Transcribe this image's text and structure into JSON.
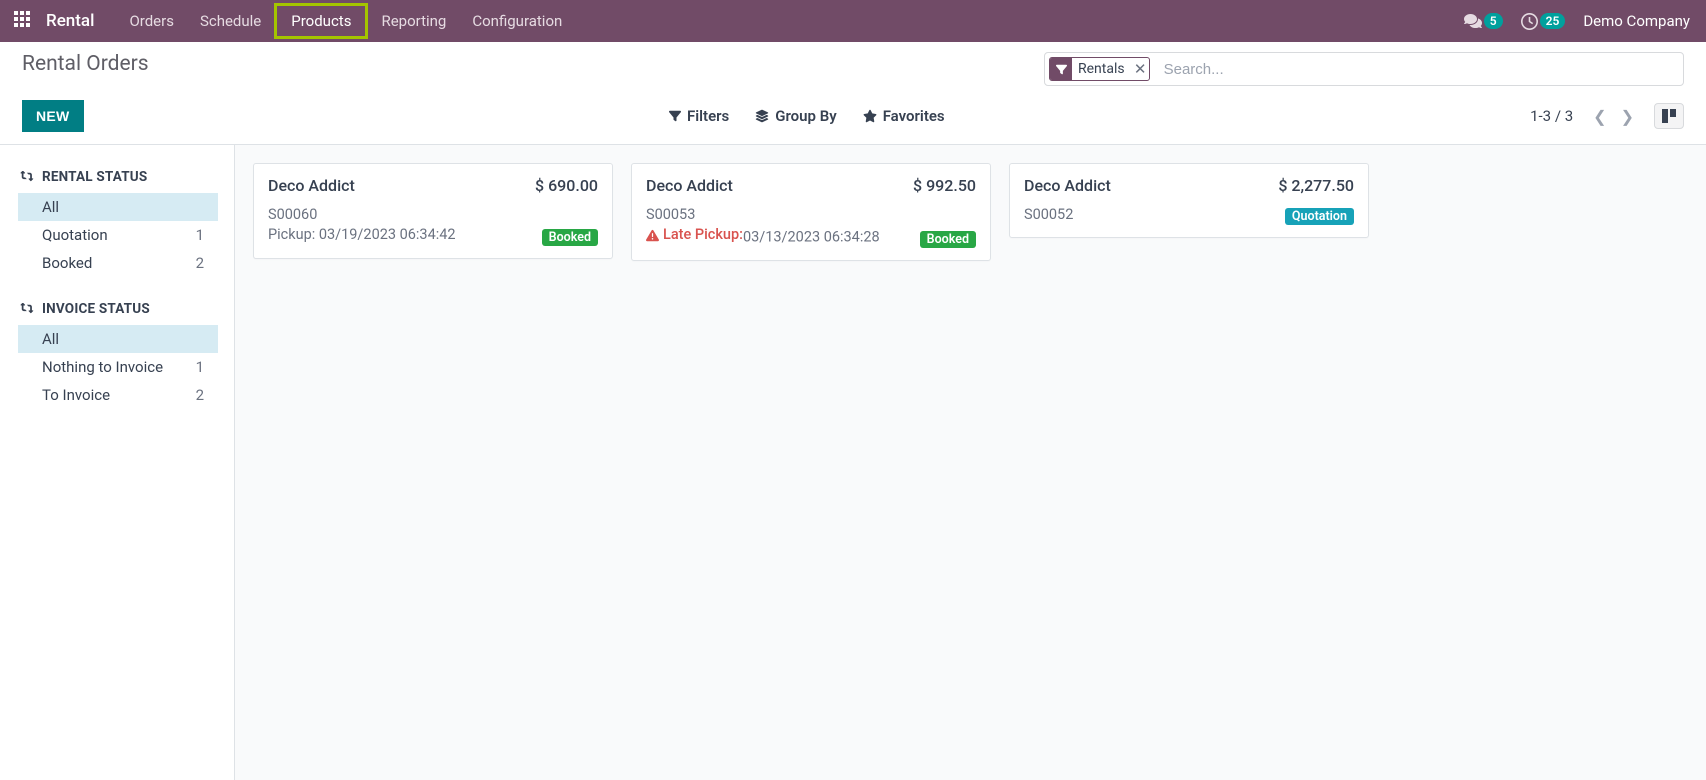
{
  "navbar": {
    "brand": "Rental",
    "links": {
      "orders": "Orders",
      "schedule": "Schedule",
      "products": "Products",
      "reporting": "Reporting",
      "configuration": "Configuration"
    },
    "messages_badge": "5",
    "activities_badge": "25",
    "company": "Demo Company"
  },
  "control": {
    "title": "Rental Orders",
    "new_btn": "NEW",
    "search_facet": "Rentals",
    "search_placeholder": "Search...",
    "filters": "Filters",
    "group_by": "Group By",
    "favorites": "Favorites",
    "pager": "1-3 / 3"
  },
  "sidebar": {
    "rental_status_title": "RENTAL STATUS",
    "rental_items": [
      {
        "label": "All",
        "count": "",
        "active": true
      },
      {
        "label": "Quotation",
        "count": "1",
        "active": false
      },
      {
        "label": "Booked",
        "count": "2",
        "active": false
      }
    ],
    "invoice_status_title": "INVOICE STATUS",
    "invoice_items": [
      {
        "label": "All",
        "count": "",
        "active": true
      },
      {
        "label": "Nothing to Invoice",
        "count": "1",
        "active": false
      },
      {
        "label": "To Invoice",
        "count": "2",
        "active": false
      }
    ]
  },
  "cards": [
    {
      "customer": "Deco Addict",
      "amount": "$ 690.00",
      "order": "S00060",
      "pickup_label": "Pickup:",
      "pickup_date": "03/19/2023 06:34:42",
      "late": false,
      "tag": "Booked",
      "tag_class": "tag-booked"
    },
    {
      "customer": "Deco Addict",
      "amount": "$ 992.50",
      "order": "S00053",
      "pickup_label": "Late Pickup:",
      "pickup_date": "03/13/2023 06:34:28",
      "late": true,
      "tag": "Booked",
      "tag_class": "tag-booked"
    },
    {
      "customer": "Deco Addict",
      "amount": "$ 2,277.50",
      "order": "S00052",
      "pickup_label": "",
      "pickup_date": "",
      "late": false,
      "tag": "Quotation",
      "tag_class": "tag-quotation"
    }
  ]
}
